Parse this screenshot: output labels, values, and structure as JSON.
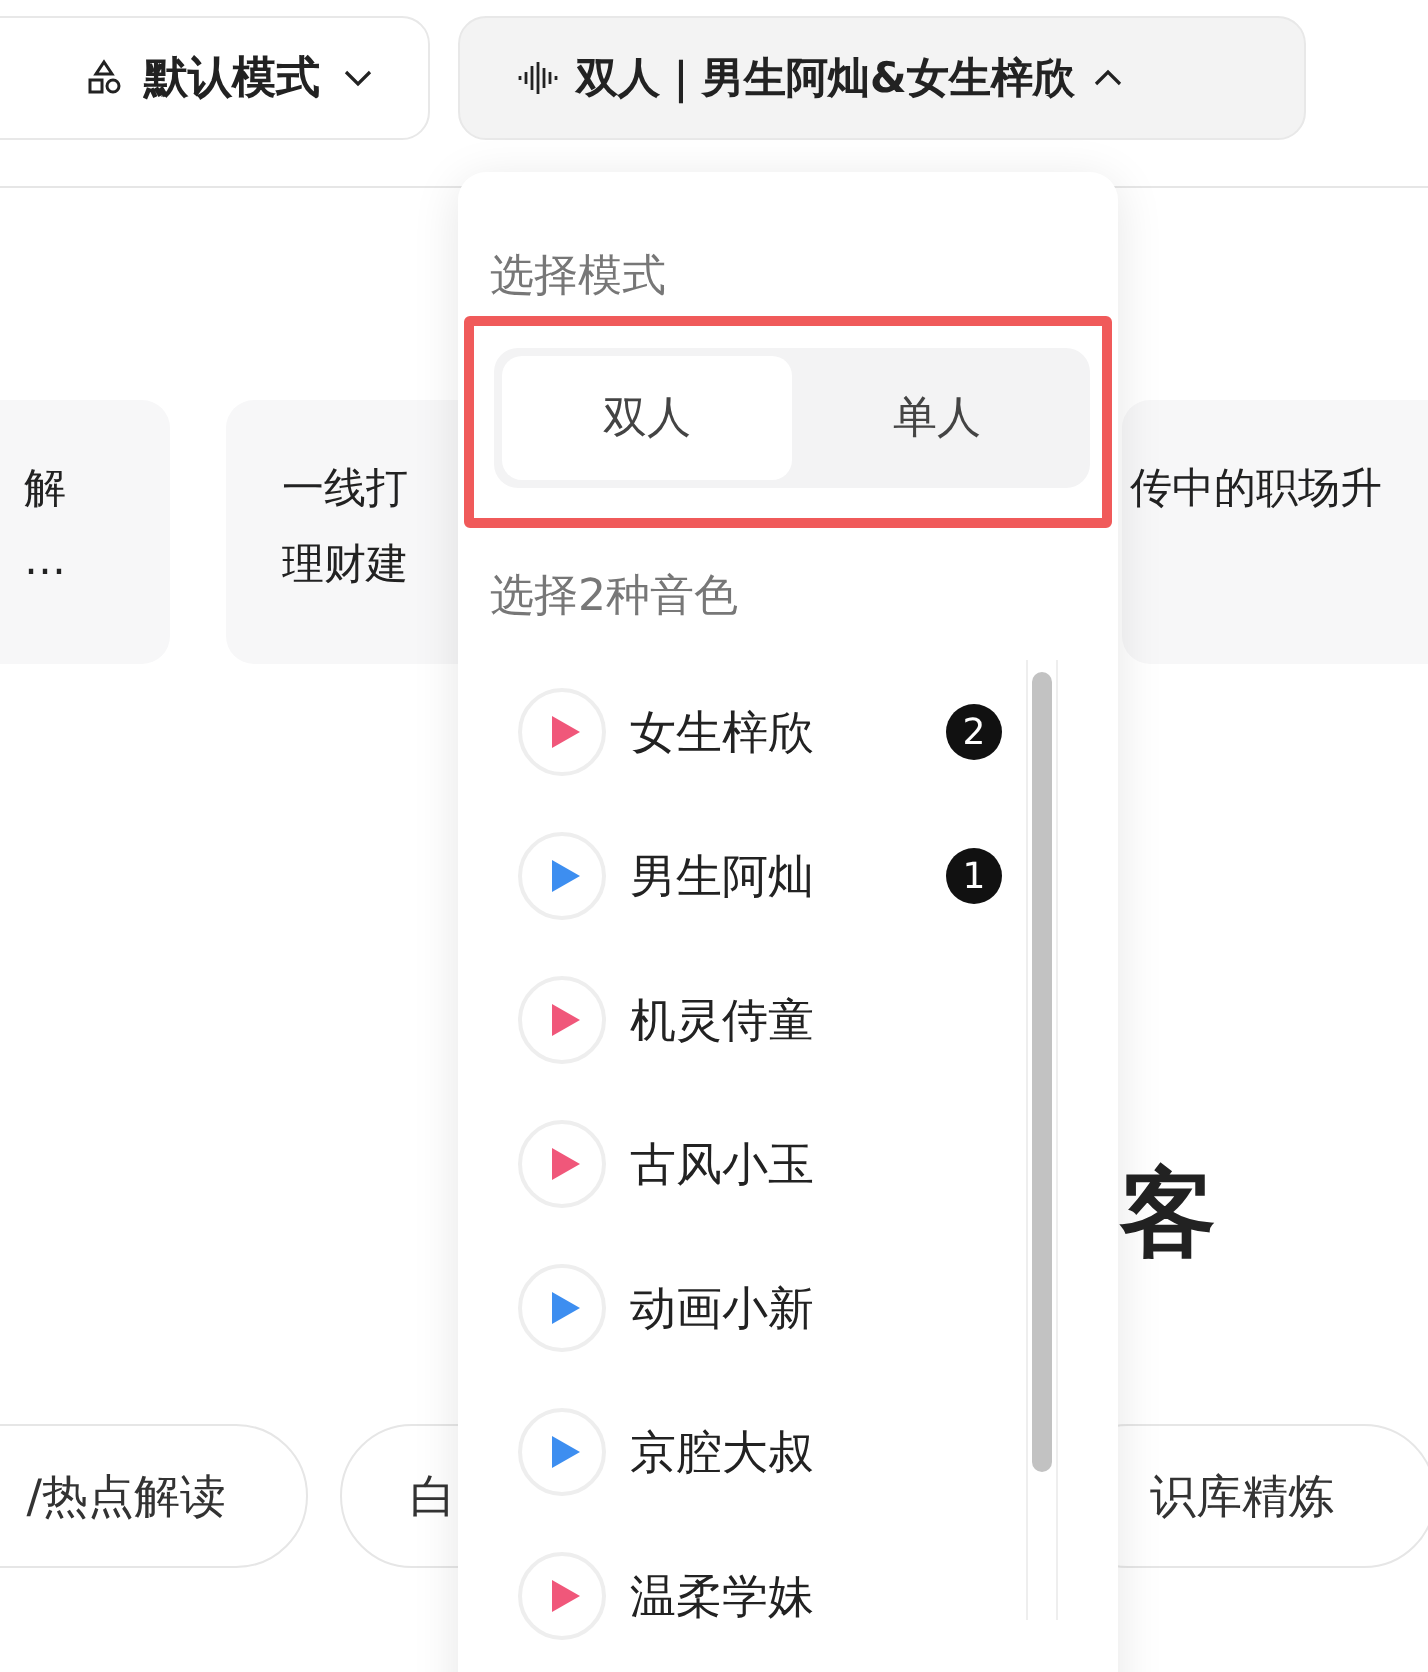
{
  "toolbar": {
    "mode_button": {
      "label": "默认模式",
      "expanded": false
    },
    "voice_button": {
      "label": "双人｜男生阿灿&女生梓欣",
      "expanded": true
    }
  },
  "cards": [
    {
      "lines": [
        "解",
        "…"
      ]
    },
    {
      "lines": [
        "一线打",
        "理财建"
      ]
    },
    {
      "lines": [
        "传中的职场升"
      ]
    }
  ],
  "heading": "客",
  "chips": [
    "/热点解读",
    "白",
    "识库精炼"
  ],
  "dropdown": {
    "mode_title": "选择模式",
    "modes": [
      {
        "label": "双人",
        "selected": true
      },
      {
        "label": "单人",
        "selected": false
      }
    ],
    "voice_title": "选择2种音色",
    "voices": [
      {
        "name": "女生梓欣",
        "color": "#f0577a",
        "badge": "2"
      },
      {
        "name": "男生阿灿",
        "color": "#3d8ef0",
        "badge": "1"
      },
      {
        "name": "机灵侍童",
        "color": "#f0577a"
      },
      {
        "name": "古风小玉",
        "color": "#f0577a"
      },
      {
        "name": "动画小新",
        "color": "#3d8ef0"
      },
      {
        "name": "京腔大叔",
        "color": "#3d8ef0"
      },
      {
        "name": "温柔学妹",
        "color": "#f0577a"
      }
    ]
  }
}
